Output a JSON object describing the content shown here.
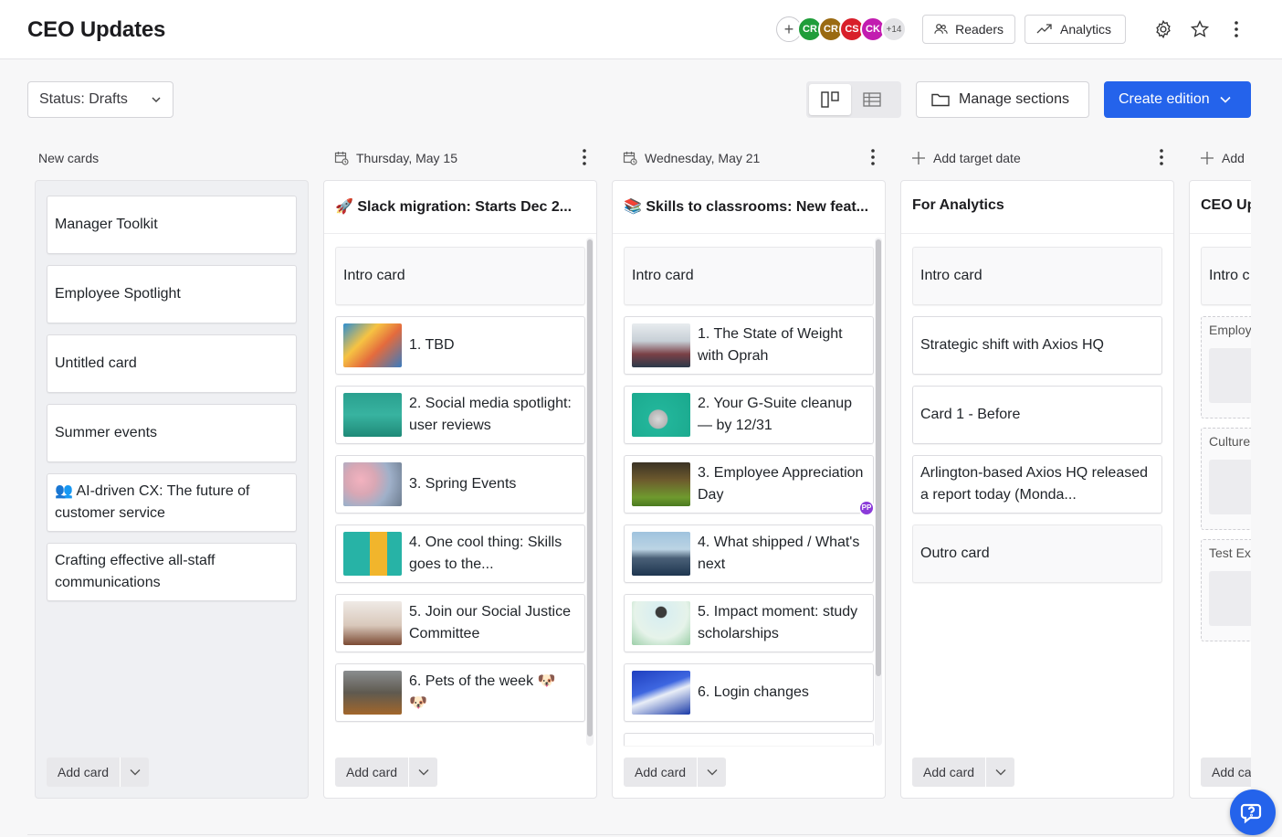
{
  "header": {
    "title": "CEO Updates",
    "avatars": [
      {
        "initials": "CR",
        "color": "#1f9d3a"
      },
      {
        "initials": "CR",
        "color": "#9a6a12"
      },
      {
        "initials": "CS",
        "color": "#d81f2a"
      },
      {
        "initials": "CK",
        "color": "#c21cb0"
      }
    ],
    "avatars_more": "+14",
    "readers_label": "Readers",
    "analytics_label": "Analytics"
  },
  "toolbar": {
    "status_label": "Status: Drafts",
    "manage_sections_label": "Manage sections",
    "create_edition_label": "Create edition",
    "accent_color": "#2463eb"
  },
  "columns": [
    {
      "header": "New cards",
      "title": "",
      "cards": [
        {
          "text": "Manager Toolkit"
        },
        {
          "text": "Employee Spotlight"
        },
        {
          "text": "Untitled card"
        },
        {
          "text": "Summer events"
        },
        {
          "text": "👥 AI-driven CX: The future of customer service"
        },
        {
          "text": "Crafting effective all-staff communications"
        }
      ],
      "add_label": "Add card"
    },
    {
      "header": "Thursday, May 15",
      "title": "🚀 Slack migration: Starts Dec 2...",
      "cards": [
        {
          "text": "Intro card"
        },
        {
          "text": "1. TBD"
        },
        {
          "text": "2. Social media spotlight: user reviews"
        },
        {
          "text": "3. Spring Events"
        },
        {
          "text": "4. One cool thing: Skills goes to the..."
        },
        {
          "text": "5. Join our Social Justice Committee"
        },
        {
          "text": "6. Pets of the week 🐶 🐶"
        }
      ],
      "add_label": "Add card"
    },
    {
      "header": "Wednesday, May 21",
      "title": "📚 Skills to classrooms: New feat...",
      "cards": [
        {
          "text": "Intro card"
        },
        {
          "text": "1. The State of Weight with Oprah"
        },
        {
          "text": "2. Your G-Suite cleanup — by 12/31"
        },
        {
          "text": "3. Employee Appreciation Day",
          "badge": "PP"
        },
        {
          "text": "4. What shipped / What's next"
        },
        {
          "text": "5. Impact moment: study scholarships"
        },
        {
          "text": "6. Login changes"
        }
      ],
      "add_label": "Add card"
    },
    {
      "header": "Add target date",
      "title": "For Analytics",
      "cards": [
        {
          "text": "Intro card"
        },
        {
          "text": "Strategic shift with Axios HQ"
        },
        {
          "text": "Card 1 - Before"
        },
        {
          "text": "Arlington-based Axios HQ released a report today (Monda..."
        },
        {
          "text": "Outro card"
        }
      ],
      "add_label": "Add card"
    },
    {
      "header": "Add",
      "title": "CEO Up",
      "cards": [
        {
          "text": "Intro c"
        }
      ],
      "placeholders": [
        "Employ",
        "Culture",
        "Test Ex"
      ],
      "add_label": "Add ca"
    }
  ]
}
